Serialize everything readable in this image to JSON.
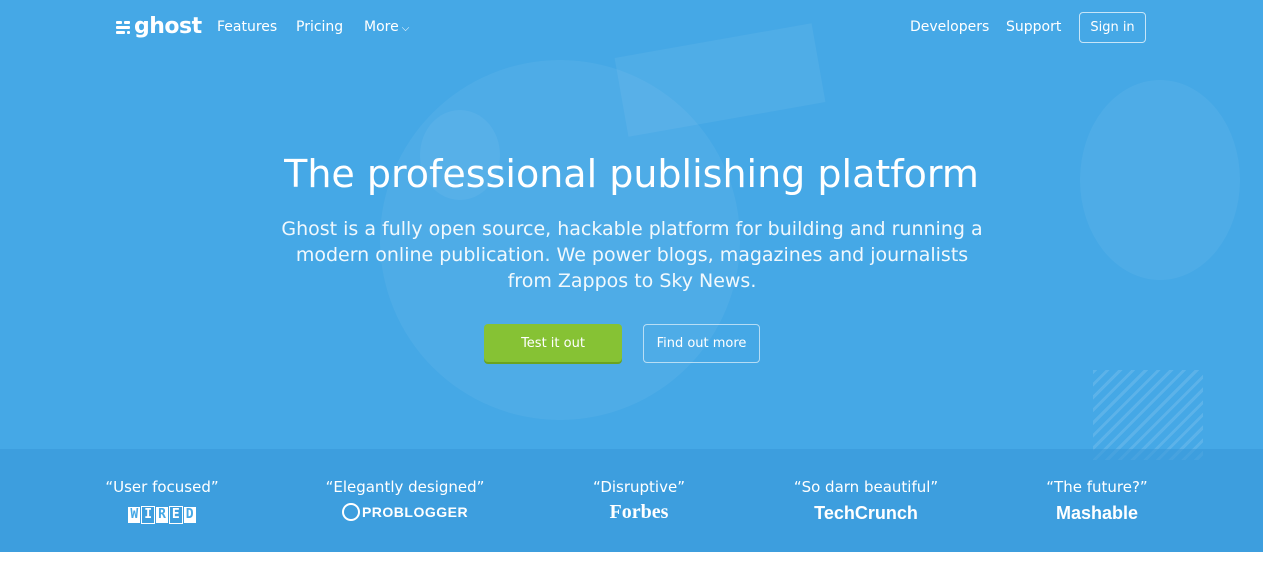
{
  "nav": {
    "logo_text": "ghost",
    "links": [
      {
        "label": "Features"
      },
      {
        "label": "Pricing"
      },
      {
        "label": "More"
      }
    ],
    "right_links": [
      {
        "label": "Developers"
      },
      {
        "label": "Support"
      }
    ],
    "signin_label": "Sign in"
  },
  "hero": {
    "title": "The professional publishing platform",
    "subtitle": "Ghost is a fully open source, hackable platform for building and running a modern online publication. We power blogs, magazines and journalists from Zappos to Sky News.",
    "primary_button": "Test it out",
    "secondary_button": "Find out more"
  },
  "press": [
    {
      "quote": "“User focused”",
      "source": "WIRED"
    },
    {
      "quote": "“Elegantly designed”",
      "source": "PROBLOGGER"
    },
    {
      "quote": "“Disruptive”",
      "source": "Forbes"
    },
    {
      "quote": "“So darn beautiful”",
      "source": "TechCrunch"
    },
    {
      "quote": "“The future?”",
      "source": "Mashable"
    }
  ],
  "colors": {
    "hero_background": "#45a8e6",
    "primary_button": "#86c234",
    "text": "#ffffff"
  },
  "icons": [
    "ghost-logo-icon",
    "chevron-down-icon",
    "problogger-p-icon"
  ]
}
